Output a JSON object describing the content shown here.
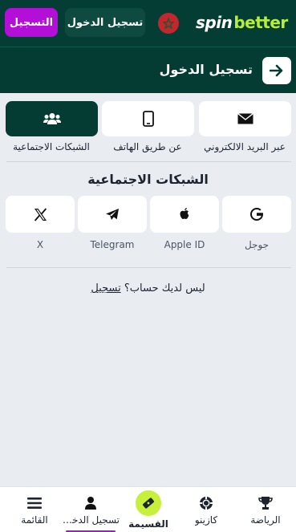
{
  "header": {
    "logo_part1": "spin",
    "logo_part2": "better",
    "login_label": "تسجيل الدخول",
    "register_label": "التسجيل"
  },
  "page": {
    "title": "تسجيل الدخول"
  },
  "methods": [
    {
      "label": "عبر البريد الالكتروني",
      "icon": "envelope-icon"
    },
    {
      "label": "عن طريق الهاتف",
      "icon": "phone-icon"
    },
    {
      "label": "الشبكات الاجتماعية",
      "icon": "users-icon",
      "active": true
    }
  ],
  "social": {
    "title": "الشبكات الاجتماعية",
    "items": [
      {
        "label": "جوجل",
        "icon": "google-icon"
      },
      {
        "label": "Apple ID",
        "icon": "apple-icon"
      },
      {
        "label": "Telegram",
        "icon": "telegram-icon"
      },
      {
        "label": "X",
        "icon": "x-icon"
      }
    ]
  },
  "footer_prompt": {
    "text": "ليس لديك حساب؟",
    "link": "تسجيل"
  },
  "bottom_nav": [
    {
      "label": "الرياضة",
      "icon": "trophy-icon"
    },
    {
      "label": "كازينو",
      "icon": "chip-icon"
    },
    {
      "label": "القسيمة",
      "icon": "ticket-icon"
    },
    {
      "label": "تسجيل الدخول",
      "icon": "user-icon"
    },
    {
      "label": "القائمة",
      "icon": "menu-icon"
    }
  ],
  "colors": {
    "header_bg": "#033d34",
    "accent_purple": "#b40fd8",
    "accent_lime": "#c6f03a"
  }
}
